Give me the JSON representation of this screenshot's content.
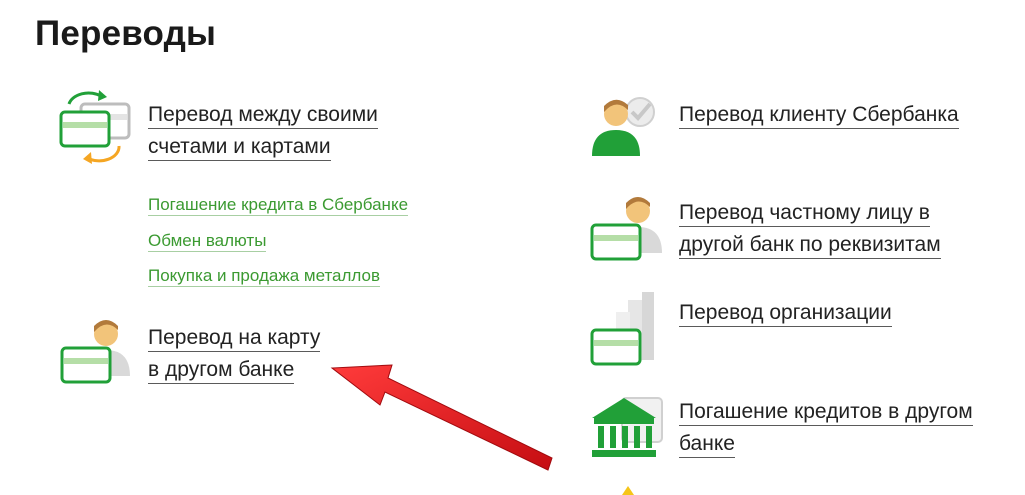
{
  "page": {
    "title": "Переводы"
  },
  "left": {
    "own_transfer": {
      "line1": "Перевод между своими",
      "line2": "счетами и картами"
    },
    "sub_links": [
      "Погашение кредита в Сбербанке",
      "Обмен валюты",
      "Покупка и продажа металлов"
    ],
    "card_other_bank": {
      "line1": "Перевод на карту",
      "line2": "в другом банке"
    }
  },
  "right": {
    "client_sber": {
      "line1": "Перевод клиенту Сбербанка"
    },
    "private_person": {
      "line1": "Перевод частному лицу в",
      "line2": "другой банк по реквизитам"
    },
    "organization": {
      "line1": "Перевод организации"
    },
    "other_bank_credit": {
      "line1": "Погашение кредитов в другом",
      "line2": "банке"
    }
  },
  "colors": {
    "accent_green": "#21a038",
    "link_green": "#3b9a31",
    "arrow_red": "#e8141c",
    "exchange_orange": "#f5a623"
  },
  "icons": [
    "transfer-between-accounts-icon",
    "person-card-icon",
    "person-sber-icon",
    "person-card-bank-icon",
    "organization-card-icon",
    "bank-building-icon"
  ]
}
